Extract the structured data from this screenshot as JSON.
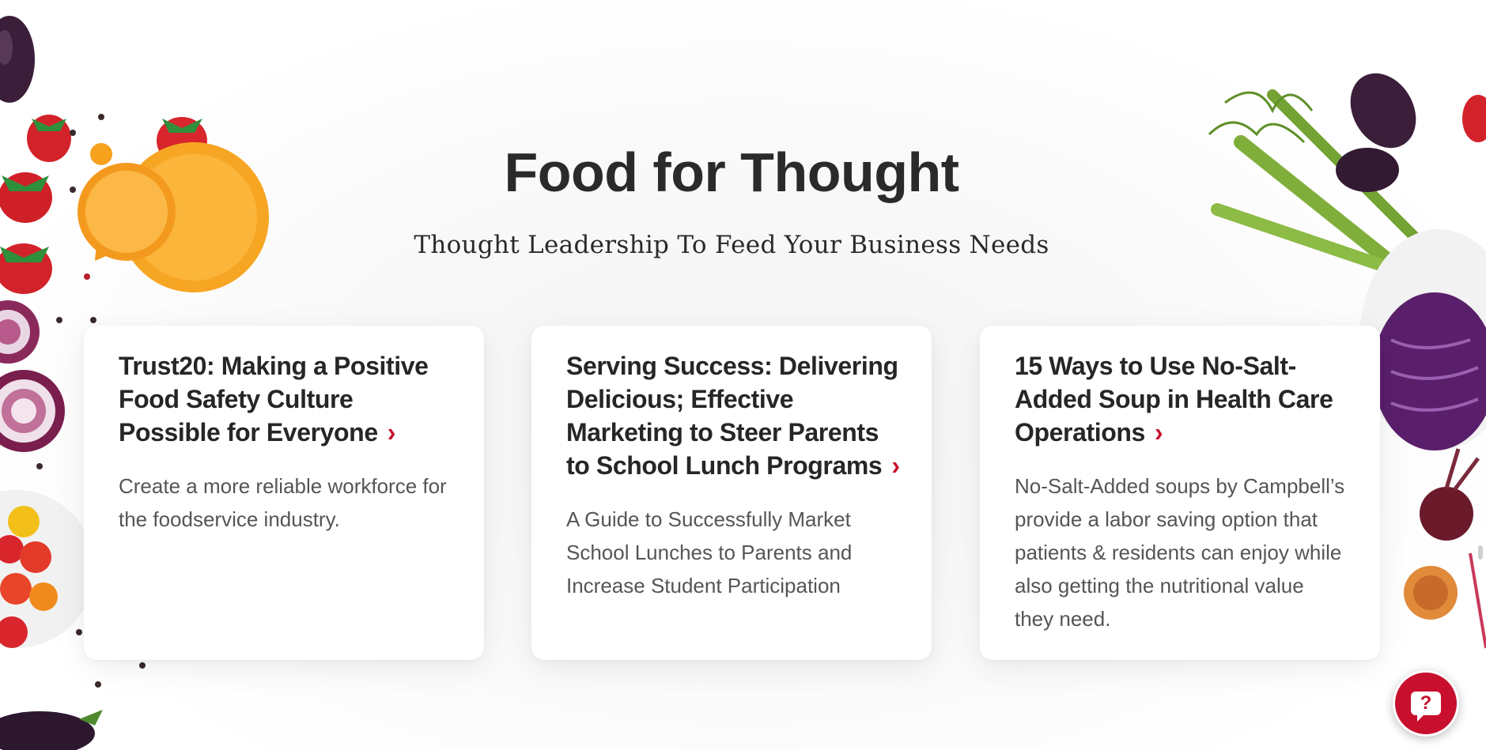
{
  "section": {
    "title": "Food for Thought",
    "subtitle": "Thought Leadership To Feed Your Business Needs"
  },
  "cards": [
    {
      "title": "Trust20: Making a Positive Food Safety Culture Possible for Everyone",
      "description": "Create a more reliable workforce for the foodservice industry."
    },
    {
      "title": "Serving Success: Delivering Delicious; Effective Marketing to Steer Parents to School Lunch Programs",
      "description": "A Guide to Successfully Market School Lunches to Parents and Increase Student Participation"
    },
    {
      "title": "15 Ways to Use No-Salt-Added Soup in Health Care Operations",
      "description": "No-Salt-Added soups by Campbell’s provide a labor saving option that patients & residents can enjoy while also getting the nutritional value they need."
    }
  ],
  "icons": {
    "card_link": "chevron-right-icon",
    "help": "help-question-icon"
  },
  "help_button": {
    "label": "?"
  },
  "colors": {
    "accent": "#c8102e",
    "heading": "#2a2a2a",
    "body_text": "#555555",
    "card_bg": "#ffffff"
  }
}
